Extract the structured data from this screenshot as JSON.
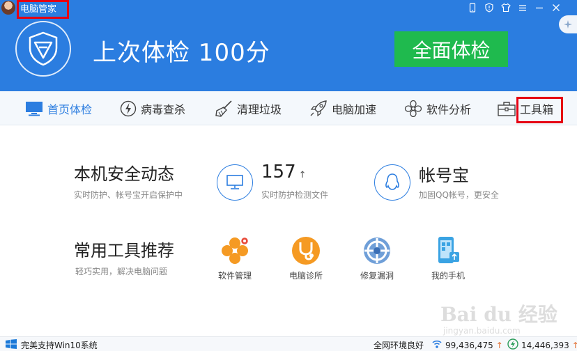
{
  "window": {
    "title": "电脑管家",
    "controls": [
      "phone-icon",
      "shield-icon",
      "shirt-icon",
      "menu-icon",
      "minimize-icon",
      "close-icon"
    ]
  },
  "header": {
    "headline": "上次体检 100分",
    "scan_button": "全面体检"
  },
  "nav": {
    "items": [
      {
        "label": "首页体检",
        "icon": "monitor-icon",
        "active": true
      },
      {
        "label": "病毒查杀",
        "icon": "lightning-icon",
        "active": false
      },
      {
        "label": "清理垃圾",
        "icon": "broom-icon",
        "active": false
      },
      {
        "label": "电脑加速",
        "icon": "rocket-icon",
        "active": false
      },
      {
        "label": "软件分析",
        "icon": "fan-icon",
        "active": false
      },
      {
        "label": "工具箱",
        "icon": "toolbox-icon",
        "active": false
      }
    ]
  },
  "security": {
    "title": "本机安全动态",
    "subtitle": "实时防护、帐号宝开启保护中",
    "stat_value": "157",
    "stat_arrow": "↑",
    "stat_label": "实时防护检测文件",
    "account_title": "帐号宝",
    "account_sub": "加固QQ帐号，更安全"
  },
  "tools": {
    "title": "常用工具推荐",
    "subtitle": "轻巧实用，解决电脑问题",
    "items": [
      {
        "label": "软件管理",
        "icon": "software-manager-icon"
      },
      {
        "label": "电脑诊所",
        "icon": "stethoscope-icon"
      },
      {
        "label": "修复漏洞",
        "icon": "patch-icon"
      },
      {
        "label": "我的手机",
        "icon": "phone-icon"
      }
    ]
  },
  "status": {
    "win10": "完美支持Win10系统",
    "network": "全网环境良好",
    "stat1": "99,436,475",
    "stat2": "14,446,393",
    "arrow": "↑"
  },
  "watermark": {
    "main": "Bai du 经验",
    "sub": "jingyan.baidu.com"
  },
  "colors": {
    "brand_blue": "#2b7de0",
    "scan_green": "#1fba4e",
    "highlight_red": "#e60012"
  }
}
